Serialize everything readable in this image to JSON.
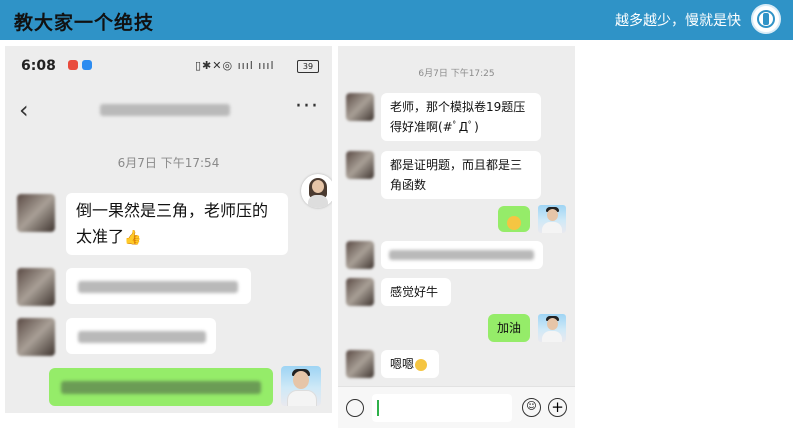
{
  "header": {
    "title": "教大家一个绝技",
    "slogan": "越多越少，慢就是快"
  },
  "left_chat": {
    "status": {
      "time": "6:08",
      "battery": "39"
    },
    "timestamp": "6月7日 下午17:54",
    "messages": [
      {
        "side": "left",
        "text": "倒一果然是三角，老师压的太准了"
      }
    ]
  },
  "right_chat": {
    "timestamp": "6月7日 下午17:25",
    "messages": [
      {
        "side": "left",
        "text": "老师，那个模拟卷19题压得好准啊(#ﾟДﾟ)"
      },
      {
        "side": "left",
        "text": "都是证明题，而且都是三角函数"
      },
      {
        "side": "left",
        "text": "感觉好牛"
      },
      {
        "side": "right",
        "text": "加油"
      },
      {
        "side": "left",
        "text": "嗯嗯"
      }
    ]
  },
  "colors": {
    "header_bg": "#2f93c7",
    "bubble_green": "#95ec69",
    "chat_bg": "#ededed"
  }
}
